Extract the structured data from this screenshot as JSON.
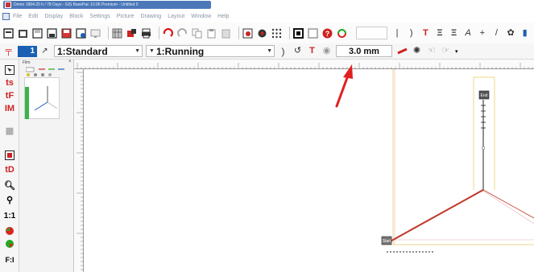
{
  "window": {
    "title": "Demo 1894.20 h / 78 Days - GiS BasePac 10.06 Premium - Untitled 5"
  },
  "menu": {
    "items": [
      "File",
      "Edit",
      "Display",
      "Block",
      "Settings",
      "Picture",
      "Drawing",
      "Layout",
      "Window",
      "Help"
    ]
  },
  "toolbar": {
    "icons": [
      "new-icon",
      "open-icon",
      "save-icon",
      "save-as-icon",
      "print-icon",
      "preview-icon",
      "grid-icon",
      "export-icon",
      "import-icon",
      "undo-icon",
      "redo-icon",
      "copy-icon",
      "paste-icon",
      "delete-icon",
      "view-icon",
      "zoom-icon",
      "dots-icon",
      "frame-icon",
      "box-icon",
      "help-icon",
      "refresh-icon"
    ]
  },
  "toolbar2": {
    "layer_number": "1",
    "style_combo": "1:Standard",
    "mode_combo": "1:Running",
    "thickness_value": "3.0 mm"
  },
  "film_panel": {
    "label": "Film",
    "close": "×"
  },
  "left_toolbar": {
    "labels": {
      "scale": "1:1",
      "fit": "F:I"
    }
  },
  "drawing": {
    "end_label": "End",
    "start_label": "Start"
  },
  "colors": {
    "accent_blue": "#1a5fb4",
    "line_red": "#c0392b",
    "guide_yellow": "#e8d98a",
    "annotation_arrow": "#e02020"
  }
}
